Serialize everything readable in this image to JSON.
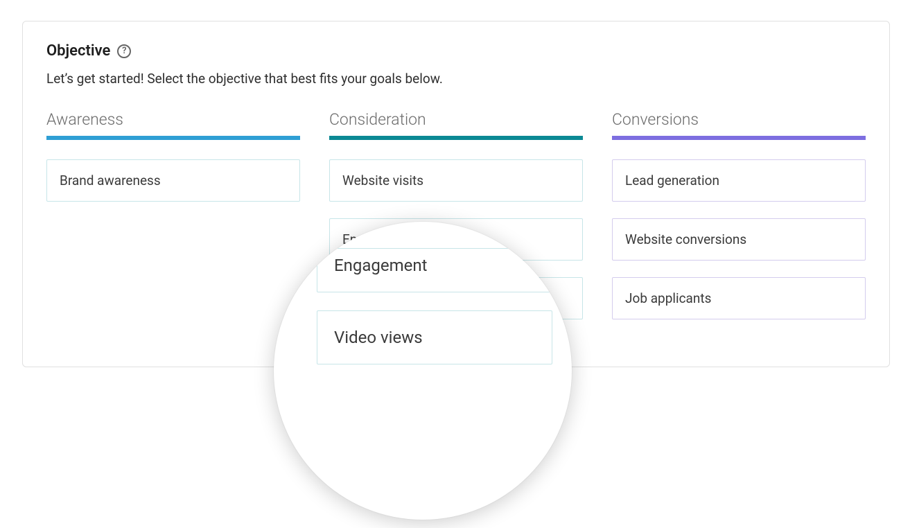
{
  "panel": {
    "title": "Objective",
    "help_glyph": "?",
    "subtitle": "Let’s get started! Select the objective that best fits your goals below."
  },
  "columns": [
    {
      "key": "awareness",
      "header": "Awareness",
      "options": [
        {
          "label": "Brand awareness"
        }
      ]
    },
    {
      "key": "consideration",
      "header": "Consideration",
      "options": [
        {
          "label": "Website visits"
        },
        {
          "label": "Engagement"
        },
        {
          "label": "Video views"
        }
      ]
    },
    {
      "key": "conversions",
      "header": "Conversions",
      "options": [
        {
          "label": "Lead generation"
        },
        {
          "label": "Website conversions"
        },
        {
          "label": "Job applicants"
        }
      ]
    }
  ],
  "magnifier": {
    "items": [
      {
        "label": "Engagement"
      },
      {
        "label": "Video views"
      }
    ]
  }
}
